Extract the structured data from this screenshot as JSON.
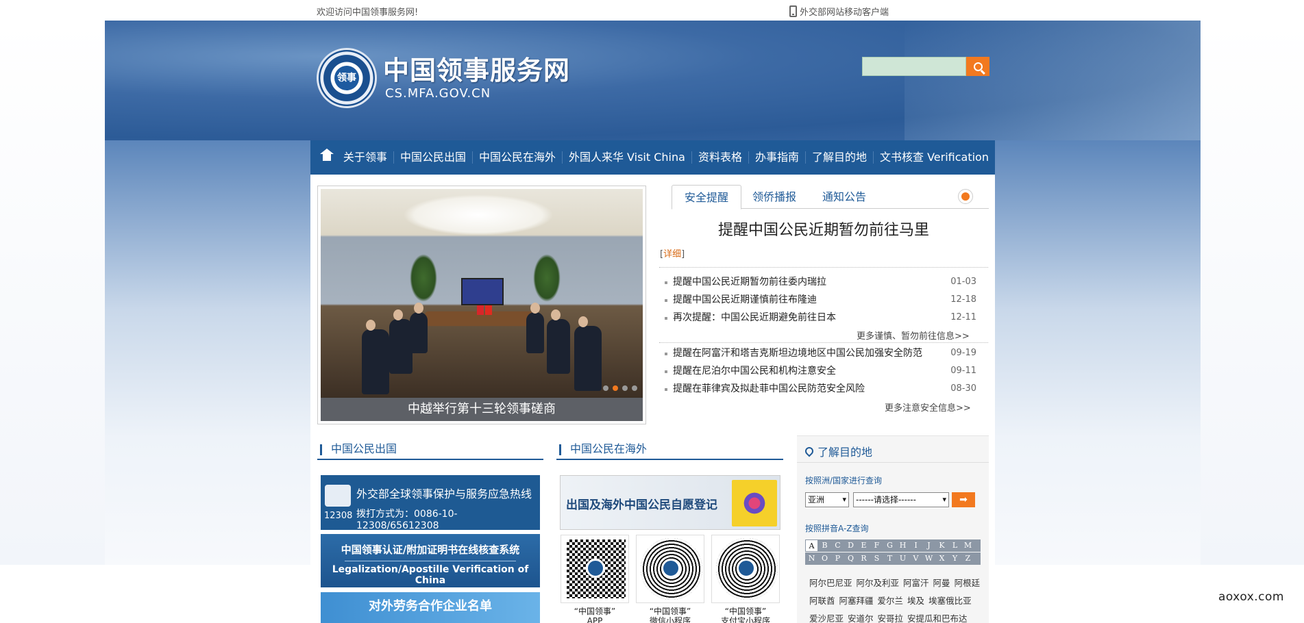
{
  "topbar": {
    "welcome": "欢迎访问中国领事服务网!",
    "mobile_link": "外交部网站移动客户端"
  },
  "header": {
    "emblem_text": "领事",
    "site_title": "中国领事服务网",
    "site_domain": "CS.MFA.GOV.CN",
    "search": {
      "placeholder": "",
      "value": ""
    }
  },
  "nav": {
    "items": [
      {
        "label": "关于领事"
      },
      {
        "label": "中国公民出国"
      },
      {
        "label": "中国公民在海外"
      },
      {
        "label": "外国人来华 Visit China"
      },
      {
        "label": "资料表格"
      },
      {
        "label": "办事指南"
      },
      {
        "label": "了解目的地"
      },
      {
        "label": "文书核查 Verification"
      }
    ]
  },
  "slider": {
    "caption": "中越举行第十三轮领事磋商",
    "dots": 4,
    "active_dot": 1
  },
  "news_tabs": {
    "tabs": [
      {
        "label": "安全提醒",
        "active": true
      },
      {
        "label": "领侨播报",
        "active": false
      },
      {
        "label": "通知公告",
        "active": false
      }
    ],
    "headline": "提醒中国公民近期暂勿前往马里",
    "detail_open": "[",
    "detail_link": "详细",
    "detail_close": "]",
    "group1": [
      {
        "title": "提醒中国公民近期暂勿前往委内瑞拉",
        "date": "01-03"
      },
      {
        "title": "提醒中国公民近期谨慎前往布隆迪",
        "date": "12-18"
      },
      {
        "title": "再次提醒：中国公民近期避免前往日本",
        "date": "12-11"
      }
    ],
    "more1": "更多谨慎、暂勿前往信息>>",
    "group2": [
      {
        "title": "提醒在阿富汗和塔吉克斯坦边境地区中国公民加强安全防范",
        "date": "09-19"
      },
      {
        "title": "提醒在尼泊尔中国公民和机构注意安全",
        "date": "09-11"
      },
      {
        "title": "提醒在菲律宾及拟赴菲中国公民防范安全风险",
        "date": "08-30"
      }
    ],
    "more2": "更多注意安全信息>>"
  },
  "section_outbound": {
    "title": "中国公民出国",
    "hotline": {
      "title": "外交部全球领事保护与服务应急热线",
      "number_label": "12308",
      "dial": "拨打方式为：0086-10-12308/65612308"
    },
    "verify": {
      "cn": "中国领事认证/附加证明书在线核查系统",
      "en": "Legalization/Apostille Verification of China"
    },
    "labor": "对外劳务合作企业名单"
  },
  "section_overseas": {
    "title": "中国公民在海外",
    "register_banner": "出国及海外中国公民自愿登记",
    "qrcodes": [
      {
        "label_line1": "“中国领事”",
        "label_line2": "APP"
      },
      {
        "label_line1": "“中国领事”",
        "label_line2": "微信小程序"
      },
      {
        "label_line1": "“中国领事”",
        "label_line2": "支付宝小程序"
      }
    ]
  },
  "destination": {
    "title": "了解目的地",
    "by_region_label": "按照洲/国家进行查询",
    "continent_select": "亚洲",
    "country_select": "------请选择------",
    "go_label": "➡",
    "by_pinyin_label": "按照拼音A-Z查询",
    "letters_row1": [
      "A",
      "B",
      "C",
      "D",
      "E",
      "F",
      "G",
      "H",
      "I",
      "J",
      "K",
      "L",
      "M"
    ],
    "letters_row2": [
      "N",
      "O",
      "P",
      "Q",
      "R",
      "S",
      "T",
      "U",
      "V",
      "W",
      "X",
      "Y",
      "Z"
    ],
    "active_letter": "A",
    "countries": [
      "阿尔巴尼亚",
      "阿尔及利亚",
      "阿富汗",
      "阿曼",
      "阿根廷",
      "阿联酋",
      "阿塞拜疆",
      "爱尔兰",
      "埃及",
      "埃塞俄比亚",
      "爱沙尼亚",
      "安道尔",
      "安哥拉",
      "安提瓜和巴布达"
    ]
  },
  "watermark": "aoxox.com",
  "colors": {
    "brand_blue": "#1f5a97",
    "accent_orange": "#f2791f"
  }
}
